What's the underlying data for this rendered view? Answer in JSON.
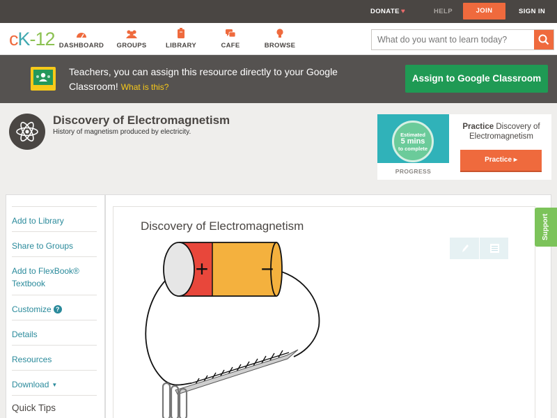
{
  "topbar": {
    "donate": "DONATE",
    "help": "HELP",
    "join": "JOIN",
    "signin": "SIGN IN"
  },
  "logo": {
    "c": "c",
    "k": "K",
    "dash": "-",
    "n": "12"
  },
  "nav": {
    "dashboard": "DASHBOARD",
    "groups": "GROUPS",
    "library": "LIBRARY",
    "cafe": "CAFE",
    "browse": "BROWSE"
  },
  "search": {
    "placeholder": "What do you want to learn today?"
  },
  "banner": {
    "text": "Teachers, you can assign this resource directly to your Google Classroom!",
    "what": "What is this?",
    "button": "Assign to Google Classroom"
  },
  "concept": {
    "title": "Discovery of Electromagnetism",
    "subtitle": "History of magnetism produced by electricity."
  },
  "practice": {
    "estimated": "Estimated",
    "mins": "5 mins",
    "complete": "to complete",
    "progress": "PROGRESS",
    "label_bold": "Practice",
    "label": "Discovery of Electromagnetism",
    "button": "Practice"
  },
  "sidebar": {
    "items": [
      {
        "label": "Add to Library"
      },
      {
        "label": "Share to Groups"
      },
      {
        "label": "Add to FlexBook®",
        "label2": "Textbook"
      },
      {
        "label": "Customize"
      },
      {
        "label": "Details"
      },
      {
        "label": "Resources"
      },
      {
        "label": "Download"
      }
    ],
    "quick_tips": "Quick Tips"
  },
  "content": {
    "title": "Discovery of Electromagnetism",
    "battery_plus": "+",
    "battery_minus": "−"
  },
  "support": "Support",
  "colors": {
    "accent": "#ef6a3d",
    "teal": "#2a8a9b",
    "green": "#1f9a54",
    "dark": "#4a4643"
  }
}
